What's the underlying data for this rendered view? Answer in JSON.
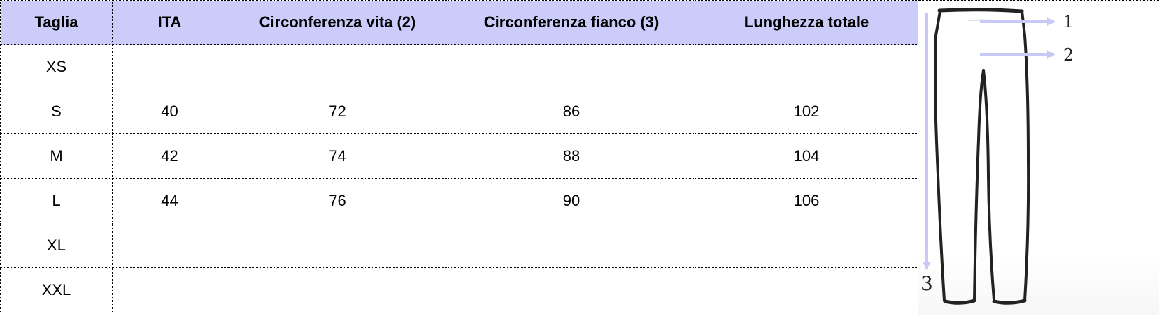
{
  "table": {
    "headers": [
      "Taglia",
      "ITA",
      "Circonferenza vita (2)",
      "Circonferenza fianco (3)",
      "Lunghezza totale"
    ],
    "rows": [
      [
        "XS",
        "",
        "",
        "",
        ""
      ],
      [
        "S",
        "40",
        "72",
        "86",
        "102"
      ],
      [
        "M",
        "42",
        "74",
        "88",
        "104"
      ],
      [
        "L",
        "44",
        "76",
        "90",
        "106"
      ],
      [
        "XL",
        "",
        "",
        "",
        ""
      ],
      [
        "XXL",
        "",
        "",
        "",
        ""
      ]
    ]
  },
  "diagram": {
    "labels": {
      "one": "1",
      "two": "2",
      "three": "3"
    },
    "colors": {
      "arrow": "#c9c9f5",
      "outline": "#222222",
      "header_bg": "#ccccfb"
    },
    "icon": "trousers-measurement-icon"
  }
}
